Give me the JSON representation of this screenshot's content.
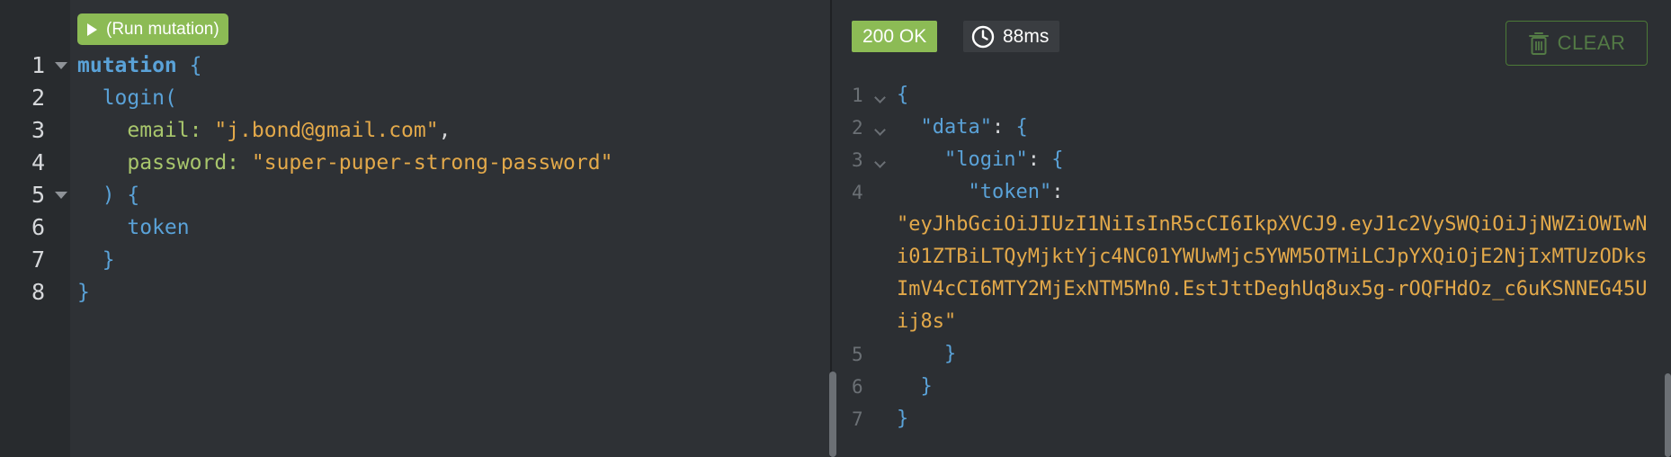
{
  "editor": {
    "run_button_label": "(Run mutation)",
    "line_numbers": [
      "1",
      "2",
      "3",
      "4",
      "5",
      "6",
      "7",
      "8"
    ],
    "code": {
      "l1_keyword": "mutation",
      "l1_brace": " {",
      "l2_field": "login(",
      "l3_arg": "email:",
      "l3_value": "\"j.bond@gmail.com\"",
      "l3_comma": ",",
      "l4_arg": "password:",
      "l4_value": "\"super-puper-strong-password\"",
      "l5_close": ") {",
      "l6_field": "token",
      "l7_close": "}",
      "l8_close": "}"
    }
  },
  "result": {
    "status": "200 OK",
    "time": "88ms",
    "clear_label": "CLEAR",
    "status_color": "#8cbb55",
    "line_numbers": [
      "1",
      "2",
      "3",
      "4",
      "5",
      "6",
      "7"
    ],
    "json": {
      "l1": "{",
      "l2_key": "\"data\"",
      "l2_colon": ": ",
      "l2_brace": "{",
      "l3_key": "\"login\"",
      "l3_colon": ": ",
      "l3_brace": "{",
      "l4_key": "\"token\"",
      "l4_colon": ":",
      "token_value": "\"eyJhbGciOiJIUzI1NiIsInR5cCI6IkpXVCJ9.eyJ1c2VySWQiOiJjNWZiOWIwNi01ZTBiLTQyMjktYjc4NC01YWUwMjc5YWM5OTMiLCJpYXQiOjE2NjIxMTUzODksImV4cCI6MTY2MjExNTM5Mn0.EstJttDeghUq8ux5g-rOQFHdOz_c6uKSNNEG45Uij8s\"",
      "l5": "}",
      "l6": "}",
      "l7": "}"
    }
  },
  "icons": {
    "play": "play-icon",
    "clock": "clock-icon",
    "trash": "trash-icon"
  }
}
